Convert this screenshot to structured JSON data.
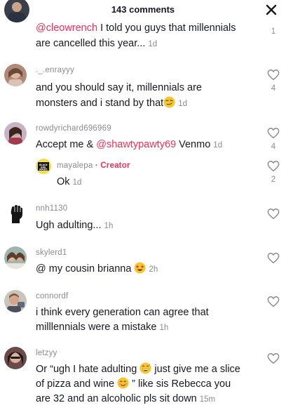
{
  "header": {
    "title": "143 comments"
  },
  "comments": [
    {
      "mention": "@cleowrench",
      "line1": " I told you guys that millennials",
      "line2": "are cancelled this year...",
      "time": "1d",
      "likes": "1"
    },
    {
      "username": "._.enrayyy",
      "line1": "and you should say it, millennials are",
      "line2": "monsters and i stand by that",
      "time": "1d",
      "likes": "4"
    },
    {
      "username": "rowdyrichard696969",
      "text_before": "Accept me & ",
      "mention": "@shawtypawty69",
      "text_after": " Venmo",
      "time": "1d",
      "likes": "4"
    },
    {
      "username": "mayalepa",
      "creator_label": "· Creator",
      "text": "Ok",
      "time": "1d",
      "likes": "2",
      "avatar_text": "BLACK GIRL MAGIC"
    },
    {
      "username": "nnh1130",
      "text": "Ugh adulting...",
      "time": "1h"
    },
    {
      "username": "skylerd1",
      "text": "@ my cousin brianna",
      "time": "2h"
    },
    {
      "username": "connordf",
      "line1": "i think every generation can agree that",
      "line2": "milllennials were a mistake",
      "time": "1h"
    },
    {
      "username": "letzyy",
      "line1a": "Or “ugh I hate adulting",
      "line1b": " just give me a slice",
      "line2a": "of pizza and wine",
      "line2b": " ” like sis Rebecca you",
      "line3": "are 32 and an alcoholic pls sit down",
      "time": "15m"
    }
  ],
  "icons": {
    "close": "close-icon",
    "like": "heart-outline-icon",
    "raised_fist": "raised-fist-icon",
    "smirk_emoji": "smirking-face-emoji",
    "star_struck_emoji": "star-struck-emoji",
    "sweat_smile_emoji": "grinning-sweat-emoji"
  },
  "colors": {
    "mention": "#fe2c55",
    "muted": "#8a8b91",
    "text": "#161823"
  }
}
